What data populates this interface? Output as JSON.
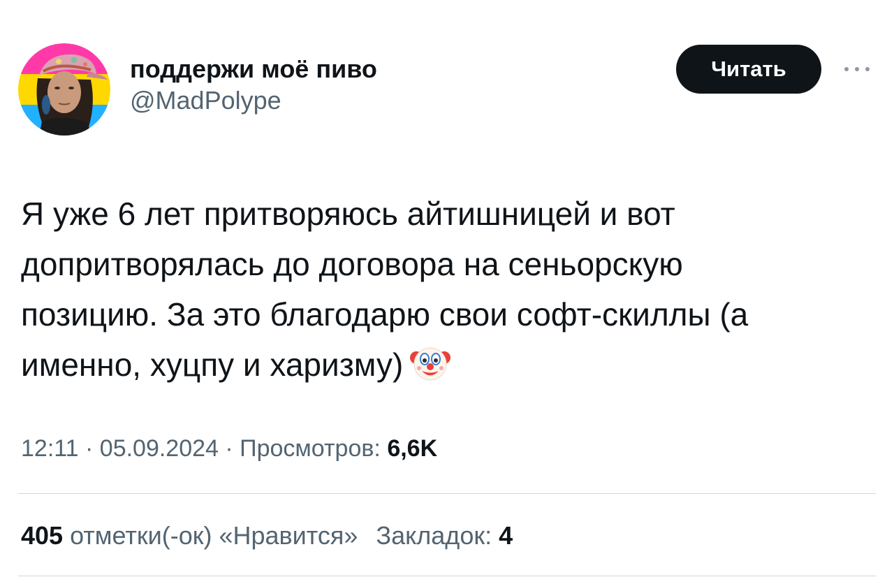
{
  "author": {
    "display_name": "поддержи моё пиво",
    "handle": "@MadPolype"
  },
  "follow_button": {
    "label": "Читать"
  },
  "more_button": {
    "icon": "more-horizontal-icon"
  },
  "tweet": {
    "text_lines": [
      "Я уже 6 лет притворяюсь айтишницей и вот",
      "допритворялась до договора на сеньорскую",
      "позицию. За это благодарю свои софт-скиллы (а",
      "именно, хуцпу и харизму)"
    ],
    "emoji": "clown-face-icon"
  },
  "meta": {
    "time": "12:11",
    "separator": " · ",
    "date": "05.09.2024",
    "views_label": "Просмотров: ",
    "views_count": "6,6K"
  },
  "stats": {
    "likes_count": "405",
    "likes_label": " отметки(-ок) «Нравится»",
    "bookmarks_label": "Закладок: ",
    "bookmarks_count": "4"
  },
  "colors": {
    "text_primary": "#0f1419",
    "text_secondary": "#536471",
    "divider": "#cfd9de",
    "button_bg": "#0f1419",
    "button_text": "#ffffff",
    "avatar_stripe_pink": "#ff3aa8",
    "avatar_stripe_yellow": "#ffd800",
    "avatar_stripe_cyan": "#21b1ff"
  }
}
